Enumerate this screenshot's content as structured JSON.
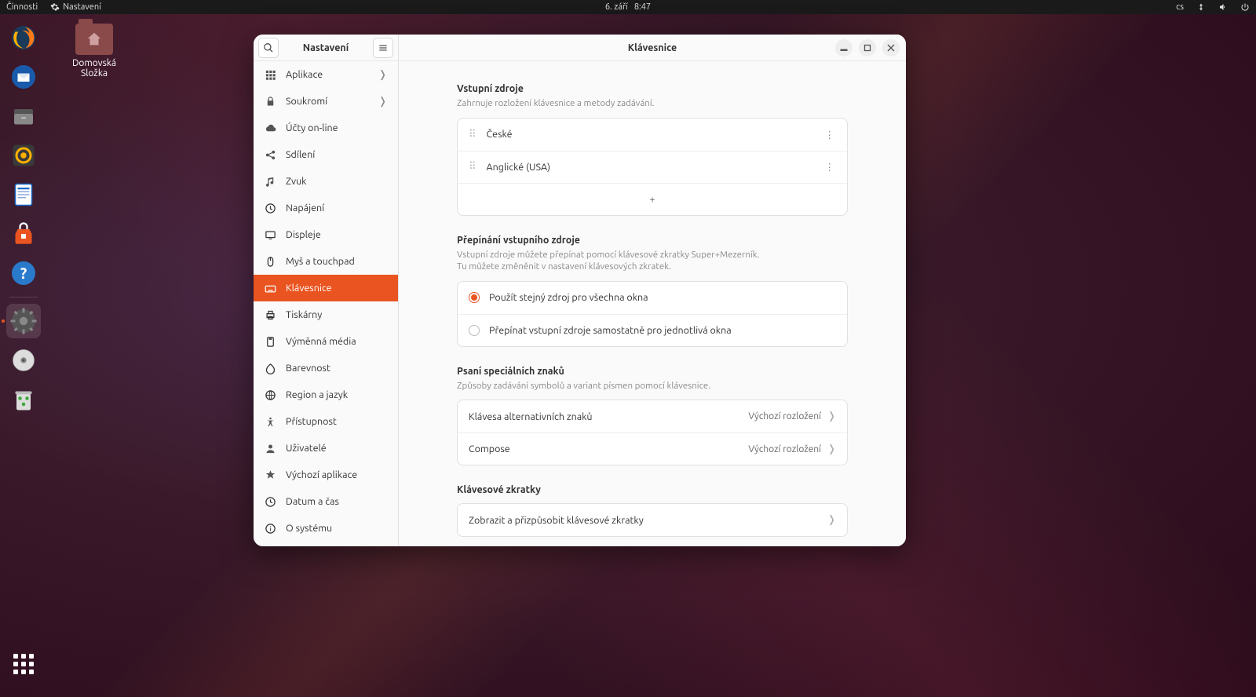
{
  "topbar": {
    "activities": "Činnosti",
    "app_name": "Nastavení",
    "date": "6. září",
    "time": "8:47",
    "lang": "cs"
  },
  "desktop": {
    "home_folder": "Domovská Složka"
  },
  "window": {
    "sidebar_title": "Nastavení",
    "content_title": "Klávesnice",
    "items": [
      {
        "id": "applications",
        "label": "Aplikace",
        "chevron": true
      },
      {
        "id": "privacy",
        "label": "Soukromí",
        "chevron": true
      },
      {
        "id": "online-accounts",
        "label": "Účty on-line"
      },
      {
        "id": "sharing",
        "label": "Sdílení"
      },
      {
        "id": "sound",
        "label": "Zvuk"
      },
      {
        "id": "power",
        "label": "Napájení"
      },
      {
        "id": "displays",
        "label": "Displeje"
      },
      {
        "id": "mouse",
        "label": "Myš a touchpad"
      },
      {
        "id": "keyboard",
        "label": "Klávesnice",
        "active": true
      },
      {
        "id": "printers",
        "label": "Tiskárny"
      },
      {
        "id": "removable",
        "label": "Výměnná média"
      },
      {
        "id": "color",
        "label": "Barevnost"
      },
      {
        "id": "region",
        "label": "Region a jazyk"
      },
      {
        "id": "accessibility",
        "label": "Přístupnost"
      },
      {
        "id": "users",
        "label": "Uživatelé"
      },
      {
        "id": "default-apps",
        "label": "Výchozí aplikace"
      },
      {
        "id": "datetime",
        "label": "Datum a čas"
      },
      {
        "id": "about",
        "label": "O systému"
      }
    ]
  },
  "keyboard": {
    "input_sources": {
      "title": "Vstupní zdroje",
      "subtitle": "Zahrnuje rozložení klávesnice a metody zadávání.",
      "items": [
        "České",
        "Anglické (USA)"
      ]
    },
    "switching": {
      "title": "Přepínání vstupního zdroje",
      "subtitle": "Vstupní zdroje můžete přepínat pomocí klávesové zkratky Super+Mezerník.\nTu můžete změněnit v nastavení klávesových zkratek.",
      "opt_same": "Použít stejný zdroj pro všechna okna",
      "opt_per_window": "Přepínat vstupní zdroje samostatně pro jednotlivá okna"
    },
    "special": {
      "title": "Psaní speciálních znaků",
      "subtitle": "Způsoby zadávání symbolů a variant písmen pomocí klávesnice.",
      "alt_key_label": "Klávesa alternativních znaků",
      "alt_key_value": "Výchozí rozložení",
      "compose_label": "Compose",
      "compose_value": "Výchozí rozložení"
    },
    "shortcuts": {
      "title": "Klávesové zkratky",
      "row": "Zobrazit a přizpůsobit klávesové zkratky"
    }
  }
}
